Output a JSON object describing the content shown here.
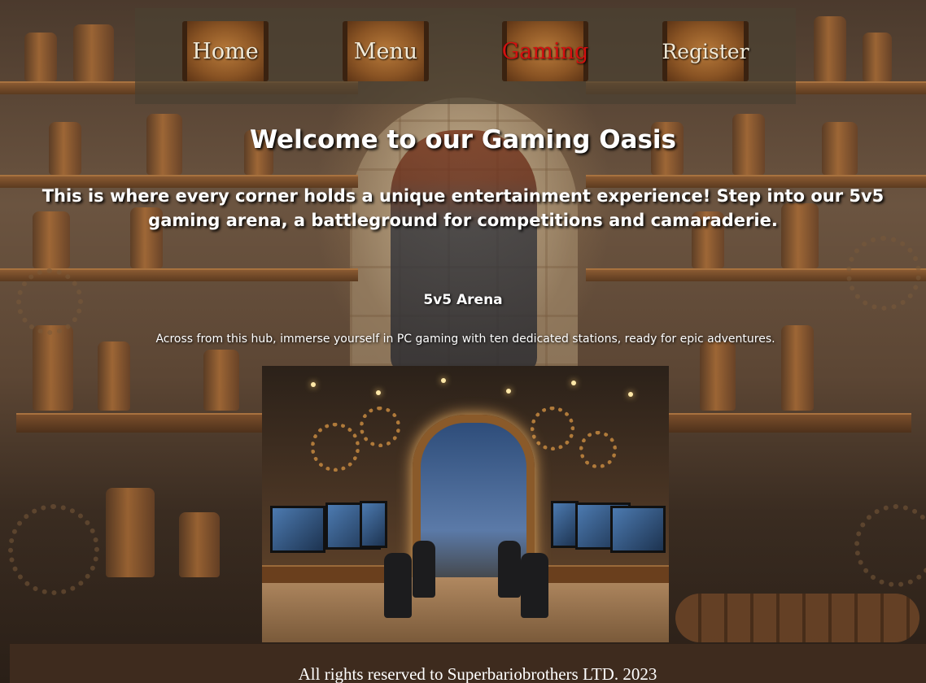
{
  "nav": {
    "items": [
      {
        "label": "Home",
        "active": false
      },
      {
        "label": "Menu",
        "active": false
      },
      {
        "label": "Gaming",
        "active": true
      },
      {
        "label": "Register",
        "active": false
      }
    ],
    "active_color": "#d40f0f"
  },
  "hero": {
    "title": "Welcome to our Gaming Oasis",
    "subtitle": "This is where every corner holds a unique entertainment experience! Step into our 5v5 gaming arena, a battleground for competitions and camaraderie."
  },
  "section": {
    "title": "5v5 Arena",
    "description": "Across from this hub, immerse yourself in PC gaming with ten dedicated stations, ready for epic adventures."
  },
  "images": {
    "arena": "arena-photo"
  },
  "footer": {
    "text": "All rights reserved to Superbariobrothers LTD. 2023"
  }
}
